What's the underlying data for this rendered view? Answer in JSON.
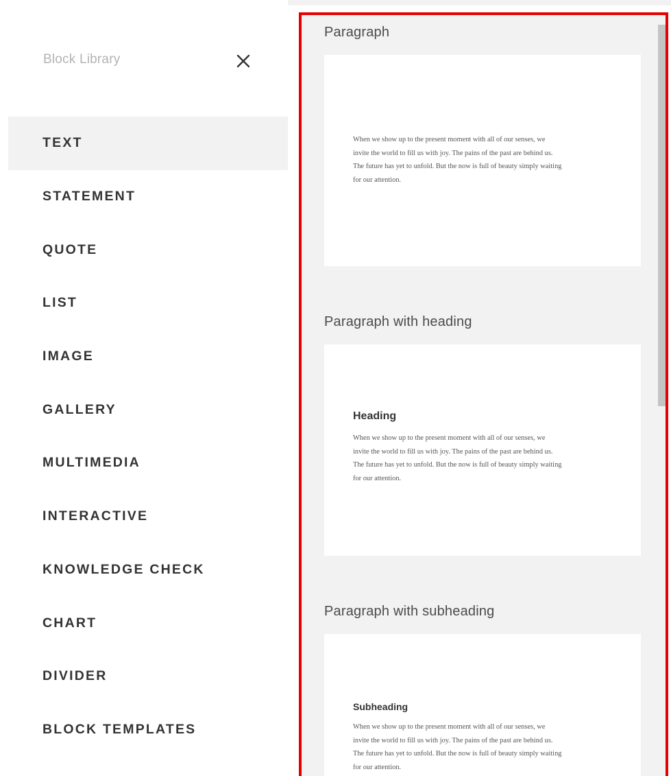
{
  "sidebar": {
    "title": "Block Library",
    "close_icon": "close-icon",
    "items": [
      {
        "label": "TEXT",
        "active": true
      },
      {
        "label": "STATEMENT"
      },
      {
        "label": "QUOTE"
      },
      {
        "label": "LIST"
      },
      {
        "label": "IMAGE"
      },
      {
        "label": "GALLERY"
      },
      {
        "label": "MULTIMEDIA"
      },
      {
        "label": "INTERACTIVE"
      },
      {
        "label": "KNOWLEDGE CHECK"
      },
      {
        "label": "CHART"
      },
      {
        "label": "DIVIDER"
      },
      {
        "label": "BLOCK TEMPLATES"
      }
    ]
  },
  "panel": {
    "highlight_color": "#e60000",
    "blocks": [
      {
        "label": "Paragraph",
        "body_lines": [
          "When we show up to the present moment with all of our senses, we",
          "invite the world to fill us with joy. The pains of the past are behind us.",
          "The future has yet to unfold. But the now is full of beauty simply waiting",
          "for our attention."
        ]
      },
      {
        "label": "Paragraph with heading",
        "heading": "Heading",
        "body_lines": [
          "When we show up to the present moment with all of our senses, we",
          "invite the world to fill us with joy. The pains of the past are behind us.",
          "The future has yet to unfold. But the now is full of beauty simply waiting",
          "for our attention."
        ]
      },
      {
        "label": "Paragraph with subheading",
        "heading": "Subheading",
        "body_lines": [
          "When we show up to the present moment with all of our senses, we",
          "invite the world to fill us with joy. The pains of the past are behind us.",
          "The future has yet to unfold. But the now is full of beauty simply waiting",
          "for our attention."
        ]
      }
    ]
  }
}
